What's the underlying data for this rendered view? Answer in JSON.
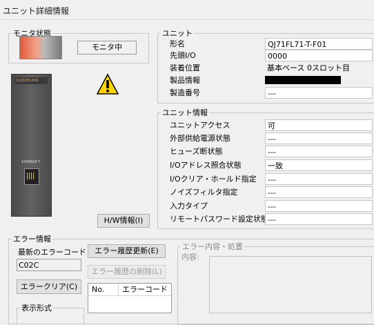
{
  "window": {
    "title": "ユニット詳細情報"
  },
  "monitor": {
    "legend": "モニタ状態",
    "status": "モニタ中"
  },
  "unit": {
    "legend": "ユニット",
    "rows": [
      {
        "label": "形名",
        "value": "QJ71FL71-T-F01"
      },
      {
        "label": "先頭I/O",
        "value": "0000"
      },
      {
        "label": "装着位置",
        "value": "基本ベース 0スロット目"
      },
      {
        "label": "製品情報",
        "value": ""
      },
      {
        "label": "製造番号",
        "value": "---"
      }
    ]
  },
  "unit_info": {
    "legend": "ユニット情報",
    "rows": [
      {
        "label": "ユニットアクセス",
        "value": "可"
      },
      {
        "label": "外部供給電源状態",
        "value": "---"
      },
      {
        "label": "ヒューズ断状態",
        "value": "---"
      },
      {
        "label": "I/Oアドレス照合状態",
        "value": "一致"
      },
      {
        "label": "I/Oクリア・ホールド指定",
        "value": "---"
      },
      {
        "label": "ノイズフィルタ指定",
        "value": "---"
      },
      {
        "label": "入力タイプ",
        "value": "---"
      },
      {
        "label": "リモートパスワード設定状態",
        "value": "---"
      }
    ]
  },
  "module_image": {
    "top_text": "CLXXXFLXXX",
    "port_label": "100BASE-T"
  },
  "buttons": {
    "hw_info": "H/W情報(I)",
    "error_history_update": "エラー履歴更新(E)",
    "error_history_delete": "エラー履歴の削除(L)",
    "error_clear": "エラークリア(C)"
  },
  "error_info": {
    "legend": "エラー情報",
    "latest_label": "最新のエラーコード",
    "latest_value": "C02C",
    "history_columns": [
      "No.",
      "エラーコード"
    ],
    "display_format_legend": "表示形式"
  },
  "error_detail": {
    "legend": "エラー内容・処置",
    "content_label": "内容:"
  },
  "colors": {
    "background": "#f0f0f0",
    "border": "#c8c8c8",
    "disabled_text": "#8a8a8a"
  }
}
